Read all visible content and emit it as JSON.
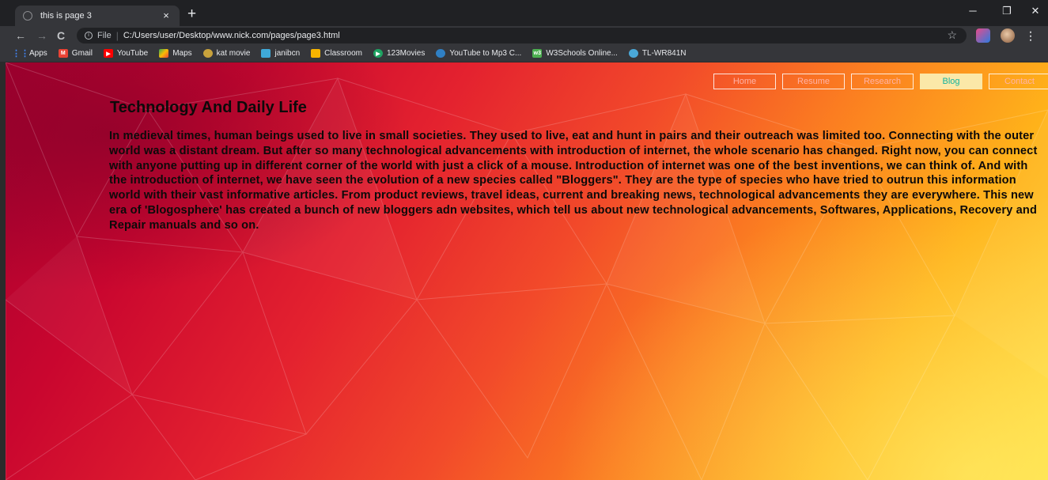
{
  "browser": {
    "tab": {
      "title": "this is page 3",
      "close": "×"
    },
    "new_tab": "+",
    "window_controls": {
      "minimize": "─",
      "restore": "❐",
      "close": "✕"
    },
    "nav": {
      "back": "←",
      "forward": "→",
      "reload": "C"
    },
    "omnibox": {
      "info": "i",
      "protocol": "File",
      "separator": "|",
      "url": "C:/Users/user/Desktop/www.nick.com/pages/page3.html",
      "star": "☆"
    },
    "menu": "⋮"
  },
  "bookmarks": [
    {
      "label": "Apps",
      "icon": "apps-grid-icon",
      "color": "#4285f4"
    },
    {
      "label": "Gmail",
      "icon": "gmail-icon",
      "color": "#ea4335"
    },
    {
      "label": "YouTube",
      "icon": "youtube-icon",
      "color": "#ff0000"
    },
    {
      "label": "Maps",
      "icon": "maps-icon",
      "color": "#34a853"
    },
    {
      "label": "kat movie",
      "icon": "kat-movie-icon",
      "color": "#c8a23c"
    },
    {
      "label": "janibcn",
      "icon": "janibcn-icon",
      "color": "#3fa9d8"
    },
    {
      "label": "Classroom",
      "icon": "classroom-icon",
      "color": "#f6b400"
    },
    {
      "label": "123Movies",
      "icon": "123movies-icon",
      "color": "#1ea362"
    },
    {
      "label": "YouTube to Mp3 C...",
      "icon": "youtube-mp3-icon",
      "color": "#2f80c4"
    },
    {
      "label": "W3Schools Online...",
      "icon": "w3schools-icon",
      "color": "#4caf50"
    },
    {
      "label": "TL-WR841N",
      "icon": "tplink-icon",
      "color": "#4aa8d8"
    }
  ],
  "site": {
    "nav": [
      {
        "label": "Home",
        "active": false
      },
      {
        "label": "Resume",
        "active": false
      },
      {
        "label": "Research",
        "active": false
      },
      {
        "label": "Blog",
        "active": true
      },
      {
        "label": "Contact",
        "active": false
      }
    ],
    "title": "Technology And Daily Life",
    "body": "In medieval times, human beings used to live in small societies. They used to live, eat and hunt in pairs and their outreach was limited too. Connecting with the outer world was a distant dream. But after so many technological advancements with introduction of internet, the whole scenario has changed. Right now, you can connect with anyone putting up in different corner of the world with just a click of a mouse. Introduction of internet was one of the best inventions, we can think of. And with the introduction of internet, we have seen the evolution of a new species called \"Bloggers\". They are the type of species who have tried to outrun this information world with their vast informative articles. From product reviews, travel ideas, current and breaking news, technological advancements they are everywhere. This new era of 'Blogosphere' has created a bunch of new bloggers adn websites, which tell us about new technological advancements, Softwares, Applications, Recovery and Repair manuals and so on."
  },
  "colors": {
    "active_nav_bg": "#fbe8a8",
    "active_nav_text": "#12b39e",
    "nav_text": "#ffb3a8",
    "background_start": "#a5002f",
    "background_end": "#ffd93a"
  }
}
